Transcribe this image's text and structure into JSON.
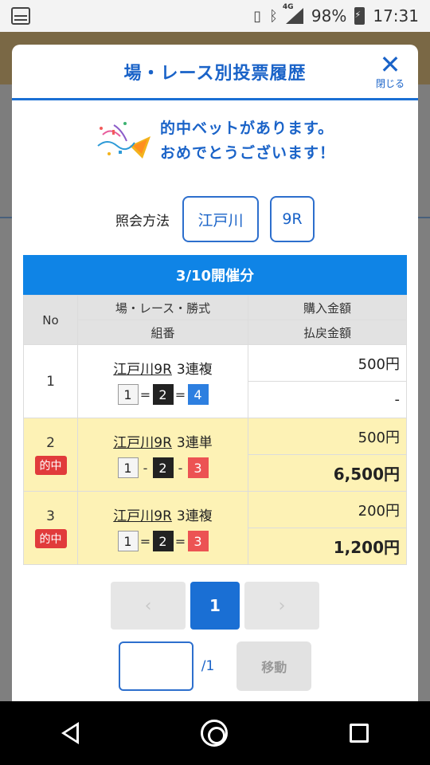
{
  "status_bar": {
    "network": "4G",
    "battery": "98%",
    "time": "17:31"
  },
  "modal": {
    "title": "場・レース別投票履歴",
    "close_label": "閉じる",
    "congrats_line1": "的中ベットがあります。",
    "congrats_line2": "おめでとうございます！",
    "lookup_label": "照会方法",
    "lookup_venue": "江戸川",
    "lookup_race": "9R"
  },
  "table": {
    "date_header": "3/10開催分",
    "headers": {
      "no": "No",
      "race_type": "場・レース・勝式",
      "combination": "組番",
      "purchase": "購入金額",
      "payout": "払戻金額"
    },
    "rows": [
      {
        "no": "1",
        "hit": "",
        "race": "江戸川9R",
        "bet_type": "3連複",
        "combo": [
          "1",
          "=",
          "2",
          "=",
          "4"
        ],
        "purchase": "500円",
        "payout": "-"
      },
      {
        "no": "2",
        "hit": "的中",
        "race": "江戸川9R",
        "bet_type": "3連単",
        "combo": [
          "1",
          "-",
          "2",
          "-",
          "3"
        ],
        "purchase": "500円",
        "payout": "6,500円"
      },
      {
        "no": "3",
        "hit": "的中",
        "race": "江戸川9R",
        "bet_type": "3連複",
        "combo": [
          "1",
          "=",
          "2",
          "=",
          "3"
        ],
        "purchase": "200円",
        "payout": "1,200円"
      }
    ]
  },
  "pagination": {
    "prev": "‹",
    "current": "1",
    "next": "›",
    "total": "/1",
    "move_label": "移動"
  },
  "colors": {
    "accent": "#1a6fd4",
    "hit_bg": "#fdf2b5",
    "hit_badge": "#e13b3b"
  }
}
